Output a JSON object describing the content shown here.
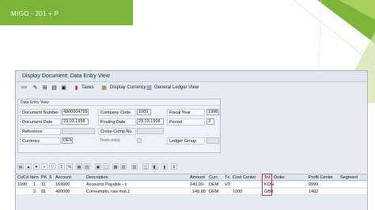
{
  "slide": {
    "title": "MIGO - 201 + P"
  },
  "window": {
    "title": "Display Document: Data Entry View"
  },
  "toolbar": {
    "taxes": "Taxes",
    "display_currency": "Display Currency",
    "general_ledger_view": "General Ledger View"
  },
  "panel": {
    "title": "Data Entry View"
  },
  "form": {
    "document_number_label": "Document Number",
    "document_number": "4900004799",
    "company_code_label": "Company Code",
    "company_code": "1000",
    "fiscal_year_label": "Fiscal Year",
    "fiscal_year": "1998",
    "document_date_label": "Document Date",
    "document_date": "23.03.1998",
    "posting_date_label": "Posting Date",
    "posting_date": "23.03.1998",
    "period_label": "Period",
    "period": "3",
    "reference_label": "Reference",
    "reference": "",
    "cross_comp_label": "Cross-Comp.No.",
    "cross_comp": "",
    "currency_label": "Currency",
    "currency": "DEM",
    "texts_exist_label": "Texts exist",
    "ledger_group_label": "Ledger Group",
    "ledger_group": ""
  },
  "grid": {
    "headers": {
      "cocd": "CoCd",
      "item": "Item",
      "pk": "PK",
      "s": "S",
      "account": "Account",
      "description": "Description",
      "amount": "Amount",
      "curr": "Curr.",
      "tx": "Tx",
      "cost_center": "Cost Center",
      "trs": "Trs",
      "order": "Order",
      "profit_center": "Profit Center",
      "segment": "Segment"
    },
    "rows": [
      {
        "cocd": "1000",
        "item": "1",
        "pk": "31",
        "s": "",
        "account": "169900",
        "description": "Accounts Payable - c",
        "amount": "140,00-",
        "curr": "DEM",
        "tx": "V0",
        "cost_center": "",
        "trs": "KON",
        "order": "",
        "profit_center": "9999",
        "segment": ""
      },
      {
        "cocd": "",
        "item": "2",
        "pk": "81",
        "s": "",
        "account": "400000",
        "description": "Consumptn, raw mat.1",
        "amount": "140,00",
        "curr": "DEM",
        "tx": "",
        "cost_center": "1000",
        "trs": "GBB",
        "order": "",
        "profit_center": "1402",
        "segment": ""
      }
    ]
  },
  "colors": {
    "accent_green": "#7db43a",
    "window_bg": "#e7ecf3",
    "highlight_red": "#d23a3a"
  },
  "icons": [
    "glasses-icon",
    "change-icon",
    "hierarchy-icon",
    "document-icon",
    "display-icon",
    "taxes-icon",
    "currency-icon",
    "ledger-icon"
  ]
}
